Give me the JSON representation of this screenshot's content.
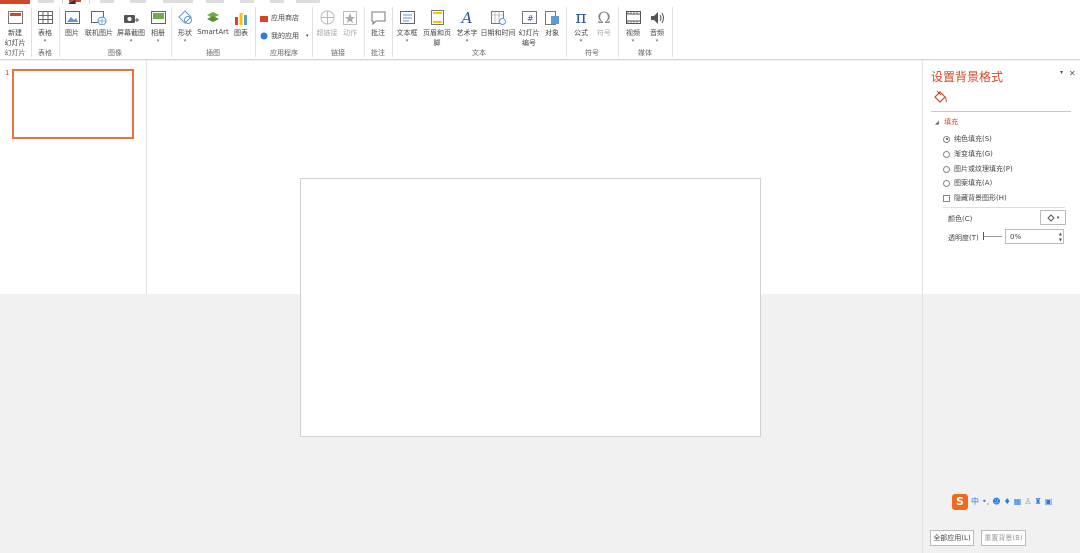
{
  "ribbon": {
    "groups": {
      "slides": "幻灯片",
      "tables": "表格",
      "images": "图像",
      "illustrations": "插图",
      "apps": "应用程序",
      "links": "链接",
      "comments": "批注",
      "text": "文本",
      "symbols": "符号",
      "media": "媒体"
    },
    "new_slide_l1": "新建",
    "new_slide_l2": "幻灯片",
    "table": "表格",
    "picture": "图片",
    "online_picture": "联机图片",
    "screenshot": "屏幕截图",
    "album": "相册",
    "shapes": "形状",
    "smartart": "SmartArt",
    "chart": "图表",
    "store": "应用商店",
    "my_apps": "我的应用",
    "hyperlink": "超链接",
    "action": "动作",
    "comment": "批注",
    "textbox": "文本框",
    "header_footer": "页眉和页脚",
    "wordart": "艺术字",
    "datetime": "日期和时间",
    "slide_number_l1": "幻灯片",
    "slide_number_l2": "编号",
    "object": "对象",
    "equation": "公式",
    "symbol": "符号",
    "video": "视频",
    "audio": "音频",
    "dropdown": "▾"
  },
  "thumbnails": {
    "slide_number": "1"
  },
  "format_pane": {
    "title": "设置背景格式",
    "collapse": "▾",
    "close": "✕",
    "section": "填充",
    "fill_options": [
      {
        "label": "纯色填充(S)",
        "selected": true
      },
      {
        "label": "渐变填充(G)",
        "selected": false
      },
      {
        "label": "图片或纹理填充(P)",
        "selected": false
      },
      {
        "label": "图案填充(A)",
        "selected": false
      }
    ],
    "hide_bg_graphics": "隐藏背景图形(H)",
    "color_label": "颜色(C)",
    "transparency_label": "透明度(T)",
    "transparency_value": "0%",
    "apply_all": "全部应用(L)",
    "reset_bg": "重置背景(B)"
  },
  "ime": {
    "logo": "S",
    "mode": "中"
  },
  "colors": {
    "accent": "#d24726",
    "thumb_border": "#e8733e",
    "ime": "#f06a1d"
  }
}
